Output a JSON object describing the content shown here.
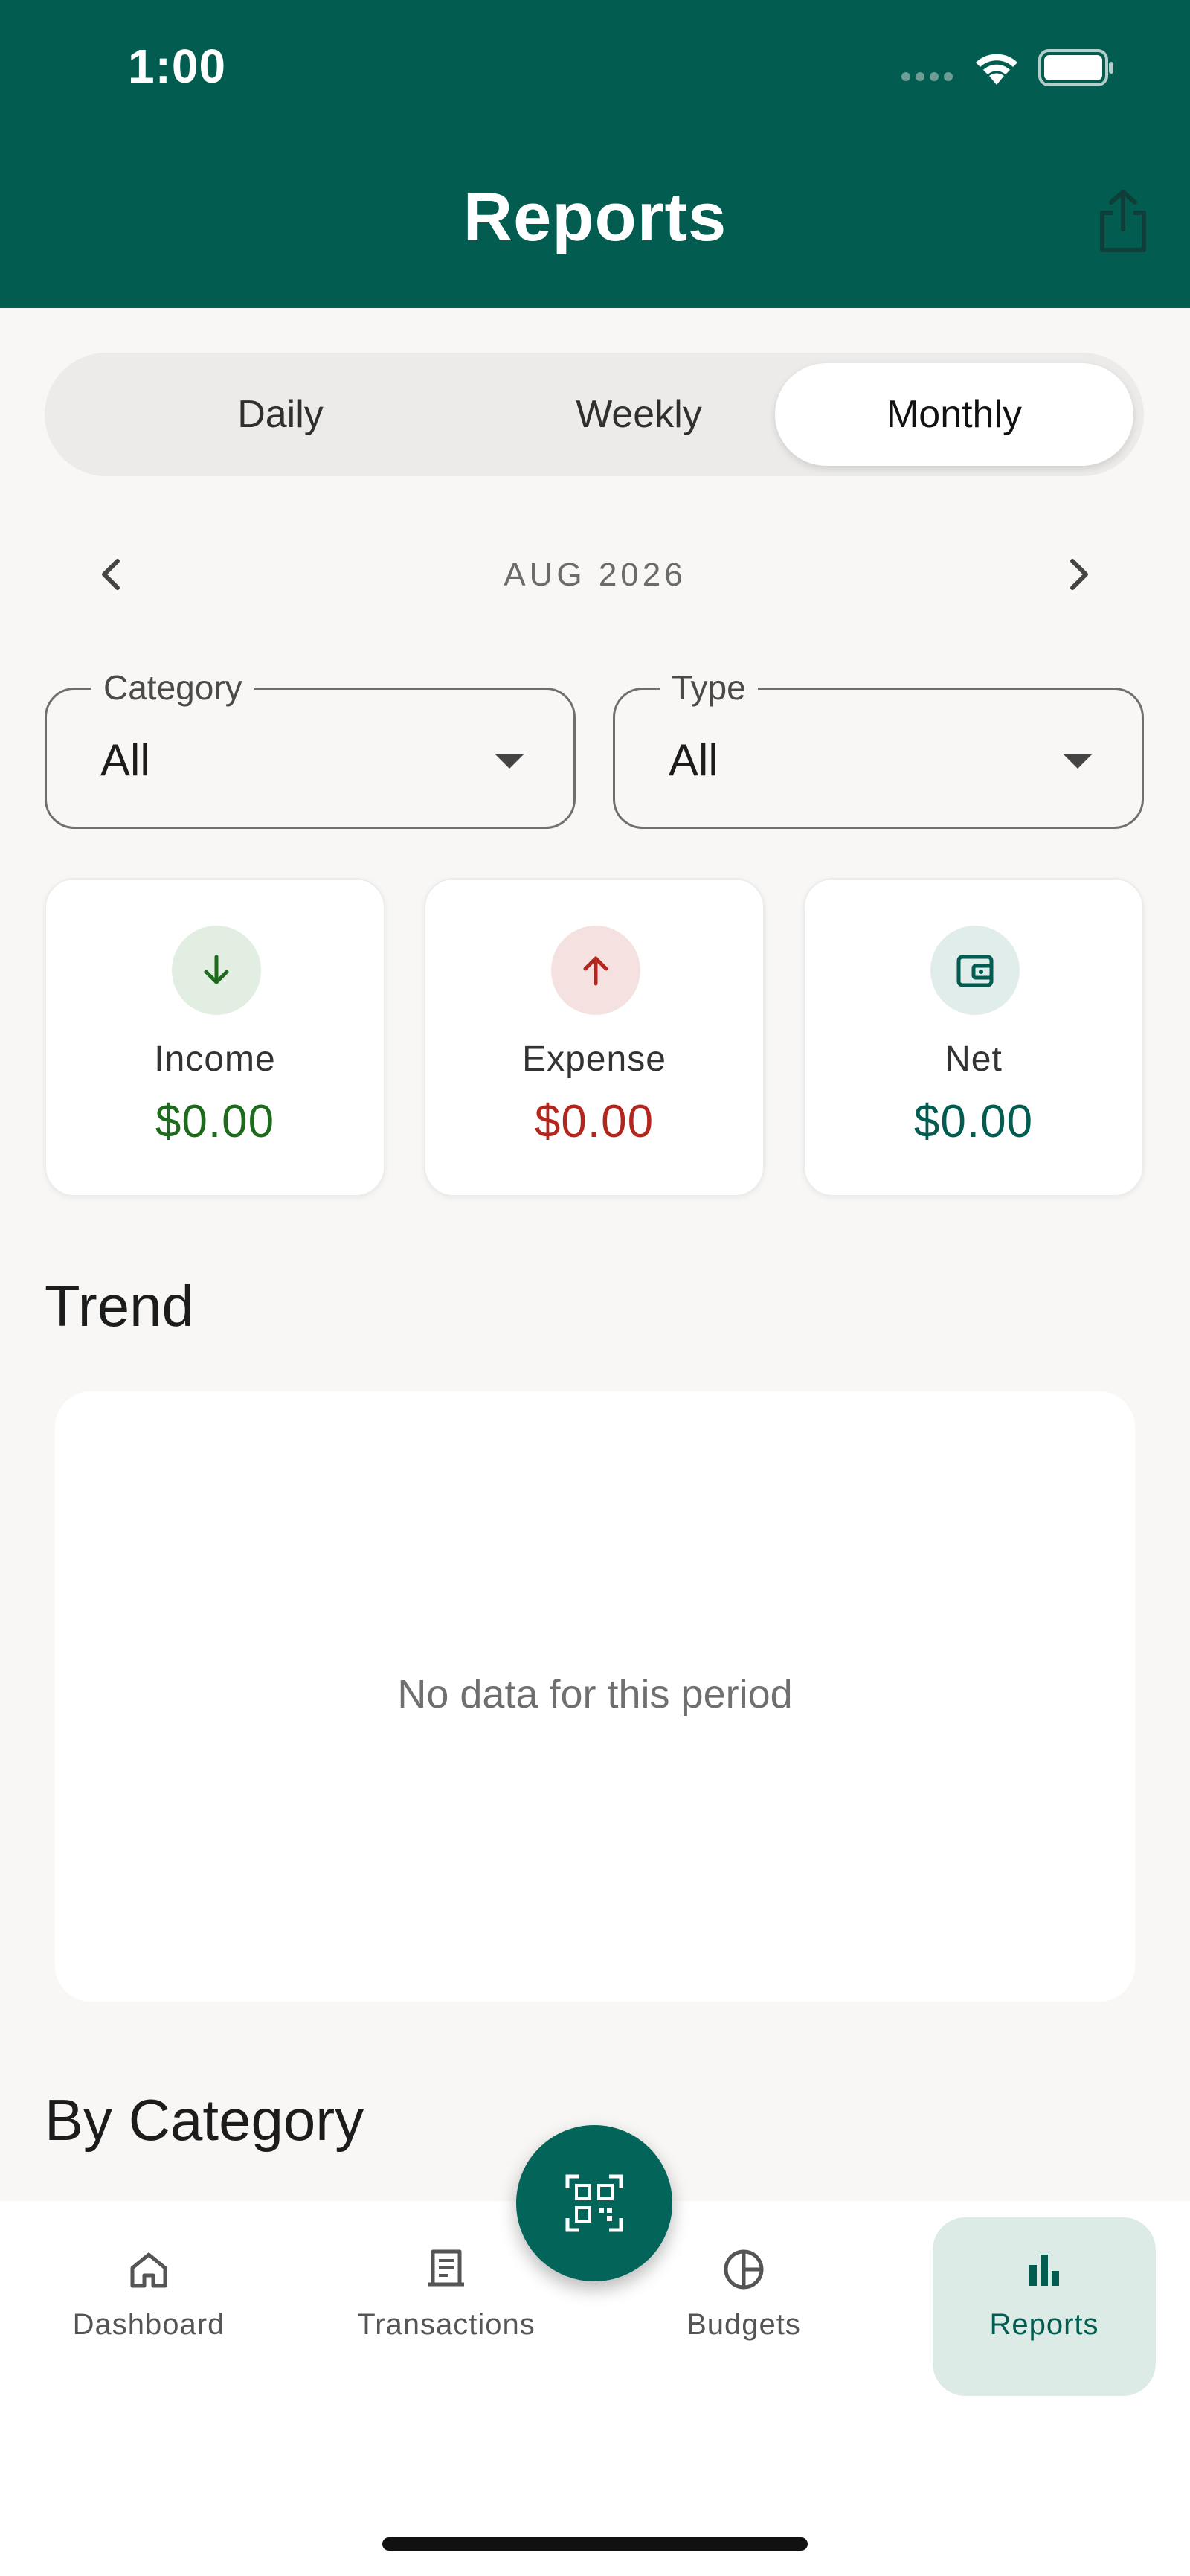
{
  "status_bar": {
    "time": "1:00"
  },
  "header": {
    "title": "Reports"
  },
  "period_tabs": [
    {
      "label": "Daily",
      "active": false
    },
    {
      "label": "Weekly",
      "active": false
    },
    {
      "label": "Monthly",
      "active": true
    }
  ],
  "period": {
    "label": "AUG 2026"
  },
  "filters": {
    "category": {
      "label": "Category",
      "value": "All"
    },
    "type": {
      "label": "Type",
      "value": "All"
    }
  },
  "summary": {
    "income": {
      "label": "Income",
      "value": "$0.00",
      "color": "#1E6B1E"
    },
    "expense": {
      "label": "Expense",
      "value": "$0.00",
      "color": "#B3261E"
    },
    "net": {
      "label": "Net",
      "value": "$0.00",
      "color": "#025C50"
    }
  },
  "trend": {
    "title": "Trend",
    "empty_message": "No data for this period"
  },
  "by_category": {
    "title": "By Category"
  },
  "bottom_nav": [
    {
      "label": "Dashboard",
      "icon": "home-icon",
      "active": false
    },
    {
      "label": "Transactions",
      "icon": "receipt-icon",
      "active": false
    },
    {
      "label": "Budgets",
      "icon": "pie-chart-icon",
      "active": false
    },
    {
      "label": "Reports",
      "icon": "bar-chart-icon",
      "active": true
    }
  ],
  "fab": {
    "icon": "qr-scan-icon"
  },
  "colors": {
    "brand": "#025C50",
    "background": "#F8F7F5",
    "active_tab_bg": "#DDEBE7"
  }
}
